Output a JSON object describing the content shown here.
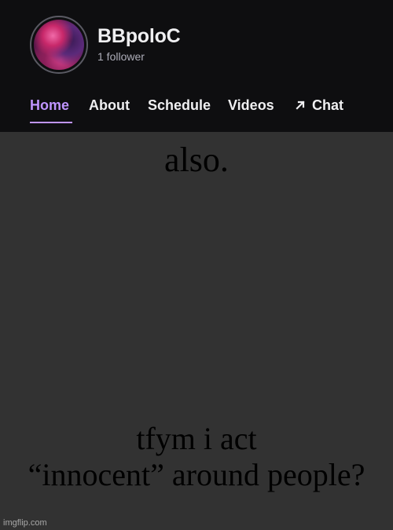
{
  "channel": {
    "name": "BBpoloC",
    "followers": "1 follower"
  },
  "nav": {
    "home": "Home",
    "about": "About",
    "schedule": "Schedule",
    "videos": "Videos",
    "chat": "Chat"
  },
  "caption": {
    "top": "also.",
    "bottom_line1": "tfym i act",
    "bottom_line2": "“innocent” around people?"
  },
  "watermark": "imgflip.com",
  "colors": {
    "header_bg": "#0e0e10",
    "body_bg": "#323232",
    "accent": "#bf94ff",
    "text_primary": "#efeff1",
    "text_secondary": "#adadb8"
  }
}
